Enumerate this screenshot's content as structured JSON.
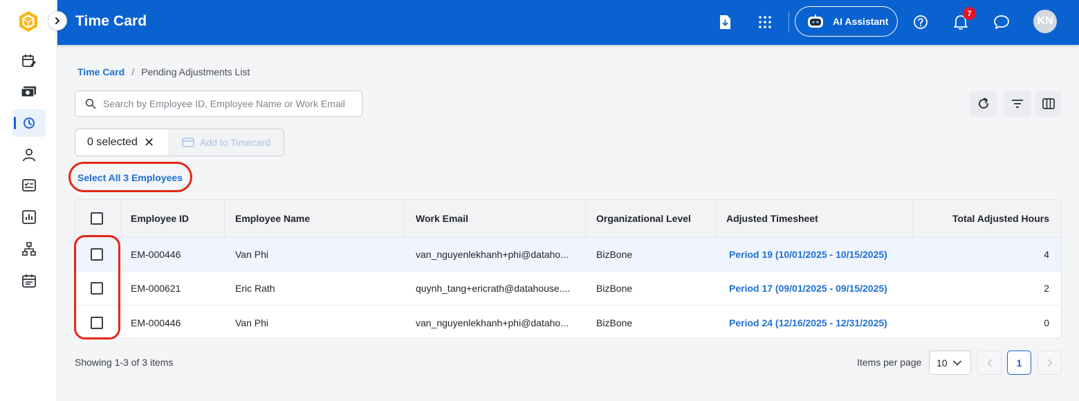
{
  "app": {
    "title": "Time Card",
    "ai_assistant_label": "AI Assistant",
    "notification_count": "7",
    "avatar_initials": "KN",
    "colors": {
      "header": "#0a62d0",
      "accent": "#1c6fd1",
      "badge": "#e0162b",
      "annotation": "#e32616"
    }
  },
  "sidebar": {
    "items": [
      {
        "icon": "calendar-edit-icon"
      },
      {
        "icon": "money-icon"
      },
      {
        "icon": "time-card-icon",
        "active": true
      },
      {
        "icon": "user-icon"
      },
      {
        "icon": "checklist-icon"
      },
      {
        "icon": "report-chart-icon"
      },
      {
        "icon": "org-chart-icon"
      },
      {
        "icon": "calendar-icon"
      }
    ]
  },
  "breadcrumb": {
    "root": "Time Card",
    "separator": "/",
    "current": "Pending Adjustments List"
  },
  "search": {
    "placeholder": "Search by Employee ID, Employee Name or Work Email",
    "value": ""
  },
  "selection": {
    "count_label": "0 selected",
    "clear_glyph": "✕",
    "add_to_timecard_label": "Add to Timecard",
    "select_all_label": "Select All 3 Employees"
  },
  "table": {
    "columns": {
      "employee_id": "Employee ID",
      "employee_name": "Employee Name",
      "work_email": "Work Email",
      "org_level": "Organizational Level",
      "adjusted_timesheet": "Adjusted Timesheet",
      "total_hours": "Total Adjusted Hours"
    },
    "rows": [
      {
        "employee_id": "EM-000446",
        "employee_name": "Van Phi",
        "work_email": "van_nguyenlekhanh+phi@dataho...",
        "org_level": "BizBone",
        "adjusted_timesheet": "Period 19 (10/01/2025 - 10/15/2025)",
        "total_hours": "4"
      },
      {
        "employee_id": "EM-000621",
        "employee_name": "Eric Rath",
        "work_email": "quynh_tang+ericrath@datahouse....",
        "org_level": "BizBone",
        "adjusted_timesheet": "Period 17 (09/01/2025 - 09/15/2025)",
        "total_hours": "2"
      },
      {
        "employee_id": "EM-000446",
        "employee_name": "Van Phi",
        "work_email": "van_nguyenlekhanh+phi@dataho...",
        "org_level": "BizBone",
        "adjusted_timesheet": "Period 24 (12/16/2025 - 12/31/2025)",
        "total_hours": "0"
      }
    ]
  },
  "pagination": {
    "showing": "Showing 1-3 of 3 items",
    "items_per_page_label": "Items per page",
    "items_per_page_value": "10",
    "current_page": "1"
  }
}
